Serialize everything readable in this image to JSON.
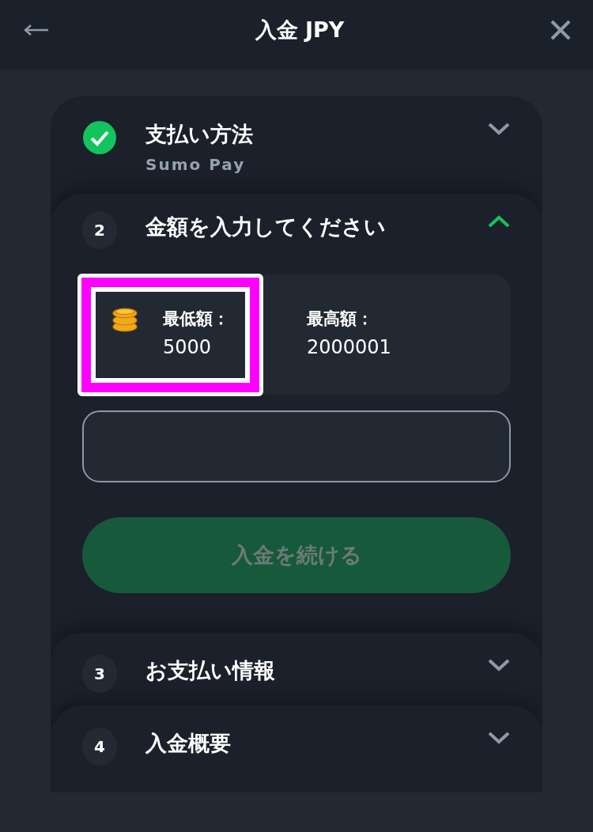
{
  "header": {
    "title": "入金 JPY"
  },
  "steps": [
    {
      "completed": true,
      "title": "支払い方法",
      "subtitle": "Sumo Pay",
      "expanded": false
    },
    {
      "completed": false,
      "number": "2",
      "title": "金額を入力してください",
      "expanded": true
    },
    {
      "completed": false,
      "number": "3",
      "title": "お支払い情報",
      "expanded": false
    },
    {
      "completed": false,
      "number": "4",
      "title": "入金概要",
      "expanded": false
    }
  ],
  "limits": [
    {
      "label": "最低額：",
      "value": "5000",
      "highlighted": true
    },
    {
      "label": "最高額：",
      "value": "2000001",
      "highlighted": false
    }
  ],
  "continue_button": {
    "label": "入金を続ける",
    "disabled": true
  }
}
